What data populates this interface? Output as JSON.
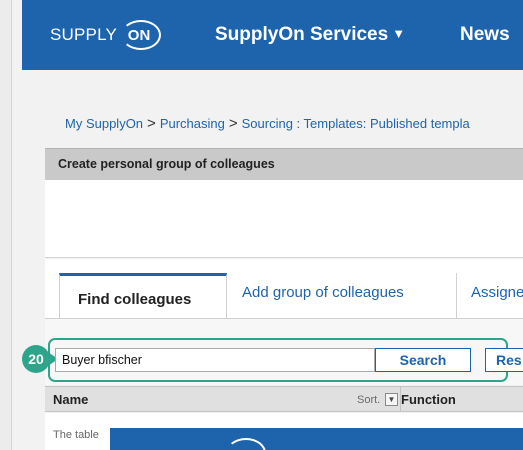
{
  "header": {
    "logo_prefix": "SUPPLY",
    "logo_suffix": "ON",
    "nav": [
      {
        "label": "SupplyOn Services"
      },
      {
        "label": "News"
      }
    ]
  },
  "breadcrumb": {
    "items": [
      "My SupplyOn",
      "Purchasing",
      "Sourcing : Templates: Published templa"
    ],
    "separator": ">"
  },
  "panel": {
    "title": "Create personal group of colleagues"
  },
  "tabs": [
    {
      "label": "Find colleagues",
      "active": true
    },
    {
      "label": "Add group of colleagues",
      "active": false
    },
    {
      "label": "Assigne",
      "active": false
    }
  ],
  "search": {
    "step_number": "20",
    "value": "Buyer bfischer",
    "search_label": "Search",
    "reset_label": "Res"
  },
  "table": {
    "columns": {
      "name": "Name",
      "sort_label": "Sort.",
      "function": "Function"
    },
    "empty_message": "The table"
  },
  "colors": {
    "brand_blue": "#1e64ad",
    "highlight_green": "#2ea58a"
  },
  "icons": {
    "nav_caret": "caret-down-icon",
    "sort": "sort-dropdown-icon",
    "step_pointer": "arrow-right-icon"
  }
}
